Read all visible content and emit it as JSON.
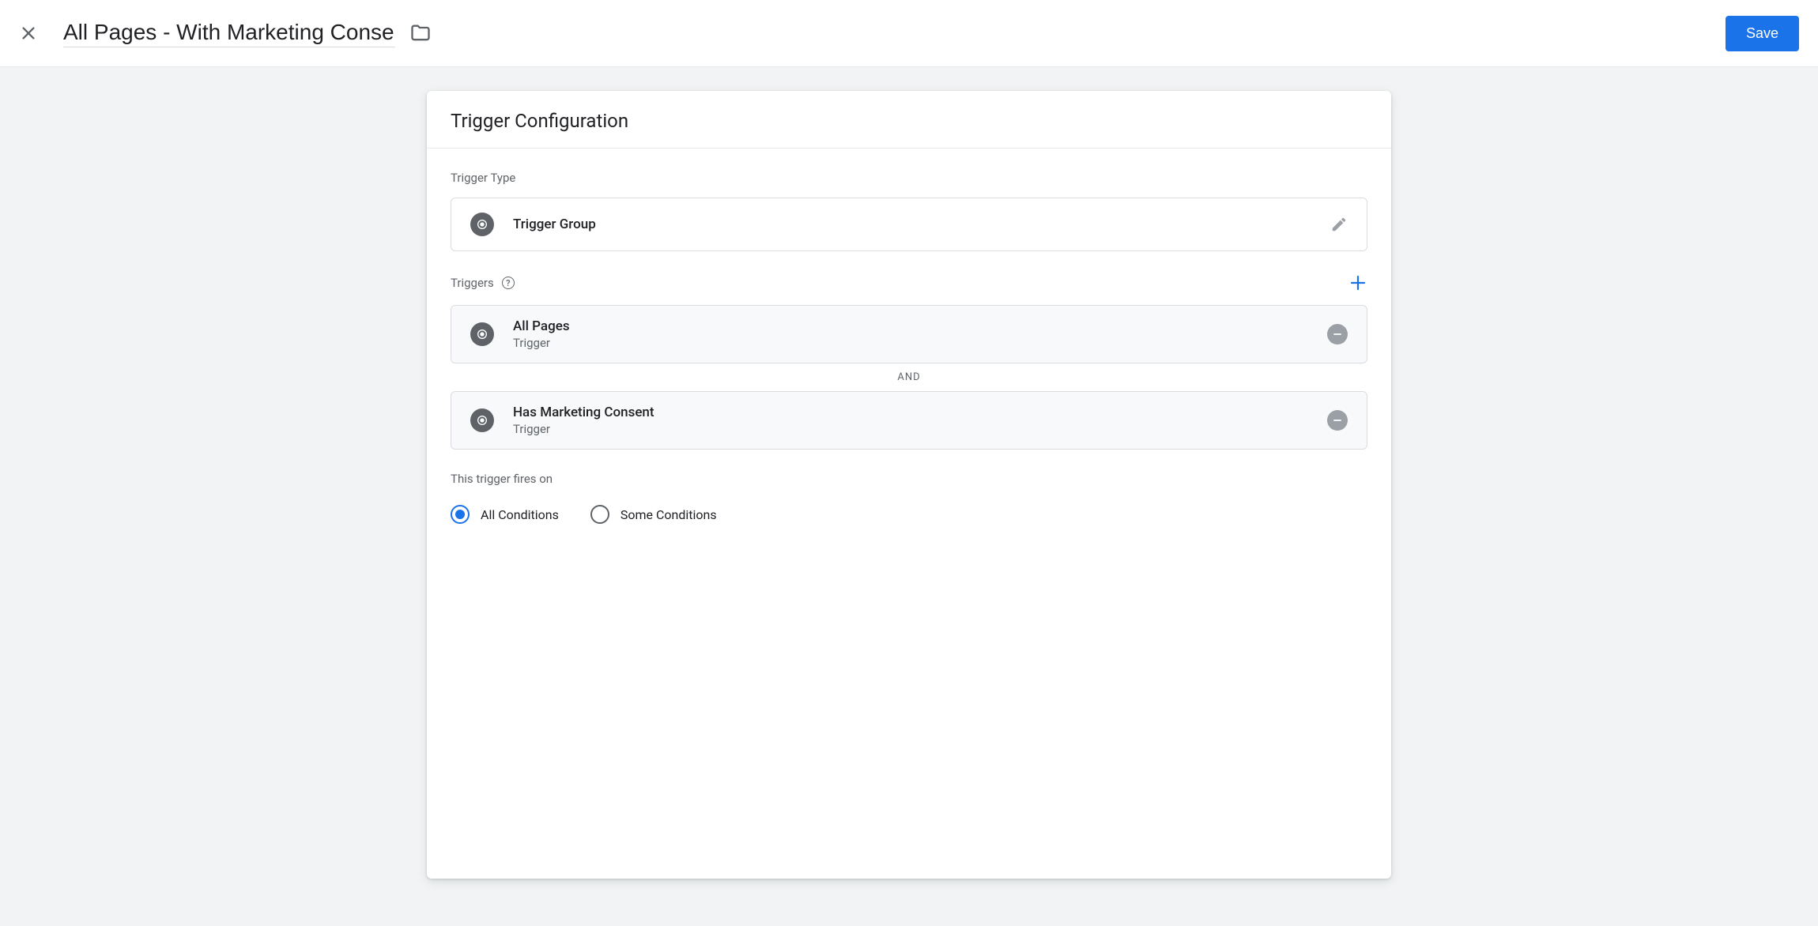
{
  "header": {
    "title": "All Pages - With Marketing Consent",
    "save_label": "Save"
  },
  "card": {
    "title": "Trigger Configuration",
    "trigger_type_label": "Trigger Type",
    "trigger_type_value": "Trigger Group",
    "triggers_label": "Triggers",
    "and_label": "AND",
    "fires_on_label": "This trigger fires on",
    "triggers": [
      {
        "name": "All Pages",
        "sub": "Trigger"
      },
      {
        "name": "Has Marketing Consent",
        "sub": "Trigger"
      }
    ],
    "conditions": [
      {
        "label": "All Conditions",
        "selected": true
      },
      {
        "label": "Some Conditions",
        "selected": false
      }
    ]
  }
}
